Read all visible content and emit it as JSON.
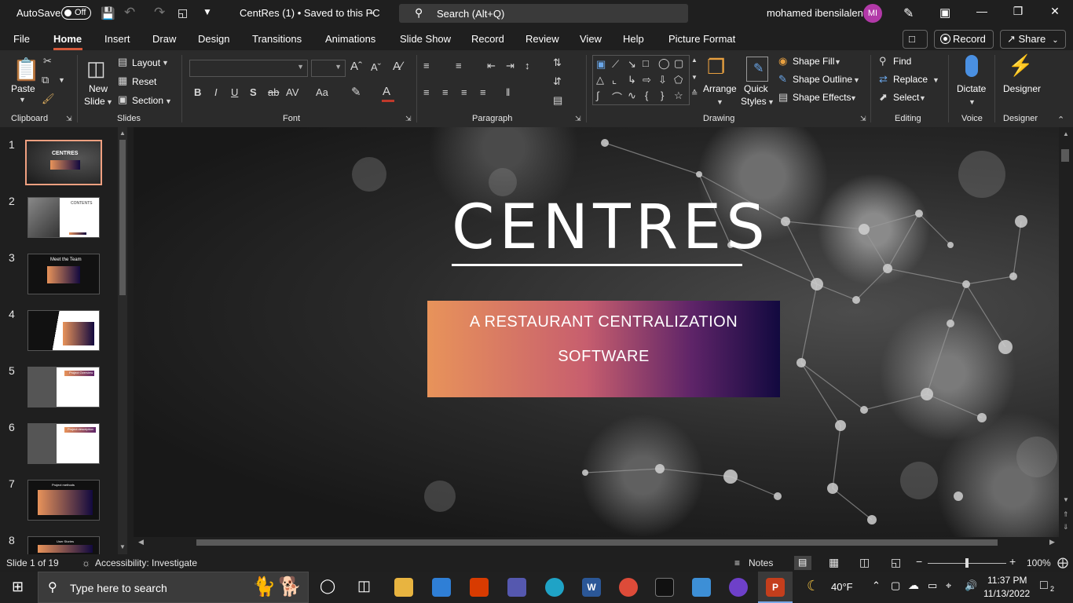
{
  "titlebar": {
    "autosave_label": "AutoSave",
    "autosave_state": "Off",
    "document_title": "CentRes (1)  •  Saved to this PC",
    "search_placeholder": "Search (Alt+Q)",
    "user_name": "mohamed ibensilalen",
    "user_initials": "MI"
  },
  "menu_tabs": [
    "File",
    "Home",
    "Insert",
    "Draw",
    "Design",
    "Transitions",
    "Animations",
    "Slide Show",
    "Record",
    "Review",
    "View",
    "Help",
    "Picture Format"
  ],
  "active_tab": "Home",
  "actions": {
    "record": "Record",
    "share": "Share"
  },
  "ribbon": {
    "clipboard": {
      "paste": "Paste",
      "label": "Clipboard"
    },
    "slides": {
      "new_slide": "New",
      "new_slide2": "Slide",
      "layout": "Layout",
      "reset": "Reset",
      "section": "Section",
      "label": "Slides"
    },
    "font": {
      "label": "Font",
      "bold": "B",
      "italic": "I",
      "underline": "U",
      "shadow": "S",
      "strike": "ab",
      "spacing": "AV",
      "case": "Aa",
      "color_a": "A"
    },
    "paragraph": {
      "label": "Paragraph"
    },
    "drawing": {
      "arrange": "Arrange",
      "quick_styles": "Quick",
      "quick_styles2": "Styles",
      "shape_fill": "Shape Fill",
      "shape_outline": "Shape Outline",
      "shape_effects": "Shape Effects",
      "label": "Drawing"
    },
    "editing": {
      "find": "Find",
      "replace": "Replace",
      "select": "Select",
      "label": "Editing"
    },
    "voice": {
      "dictate": "Dictate",
      "label": "Voice"
    },
    "designer": {
      "designer": "Designer",
      "label": "Designer"
    }
  },
  "thumbnails": [
    {
      "num": "1",
      "caption": "CENTRES"
    },
    {
      "num": "2",
      "caption": "CONTENTS"
    },
    {
      "num": "3",
      "caption": "Meet the Team"
    },
    {
      "num": "4",
      "caption": ""
    },
    {
      "num": "5",
      "caption": "Project Overview"
    },
    {
      "num": "6",
      "caption": "Project description"
    },
    {
      "num": "7",
      "caption": "Project methods"
    },
    {
      "num": "8",
      "caption": "User Stories"
    }
  ],
  "slide": {
    "title": "CENTRES",
    "subtitle_line1": "A RESTAURANT CENTRALIZATION",
    "subtitle_line2": "SOFTWARE"
  },
  "statusbar": {
    "slide_info": "Slide 1 of 19",
    "accessibility": "Accessibility: Investigate",
    "notes": "Notes",
    "zoom": "100%",
    "zoom_level": 0.5
  },
  "taskbar": {
    "search_placeholder": "Type here to search",
    "weather": "40°F",
    "time": "11:37 PM",
    "date": "11/13/2022",
    "notifications": "2"
  },
  "colors": {
    "accent": "#d65a3b",
    "gradient_start": "#e8935a",
    "gradient_end": "#12093f"
  }
}
